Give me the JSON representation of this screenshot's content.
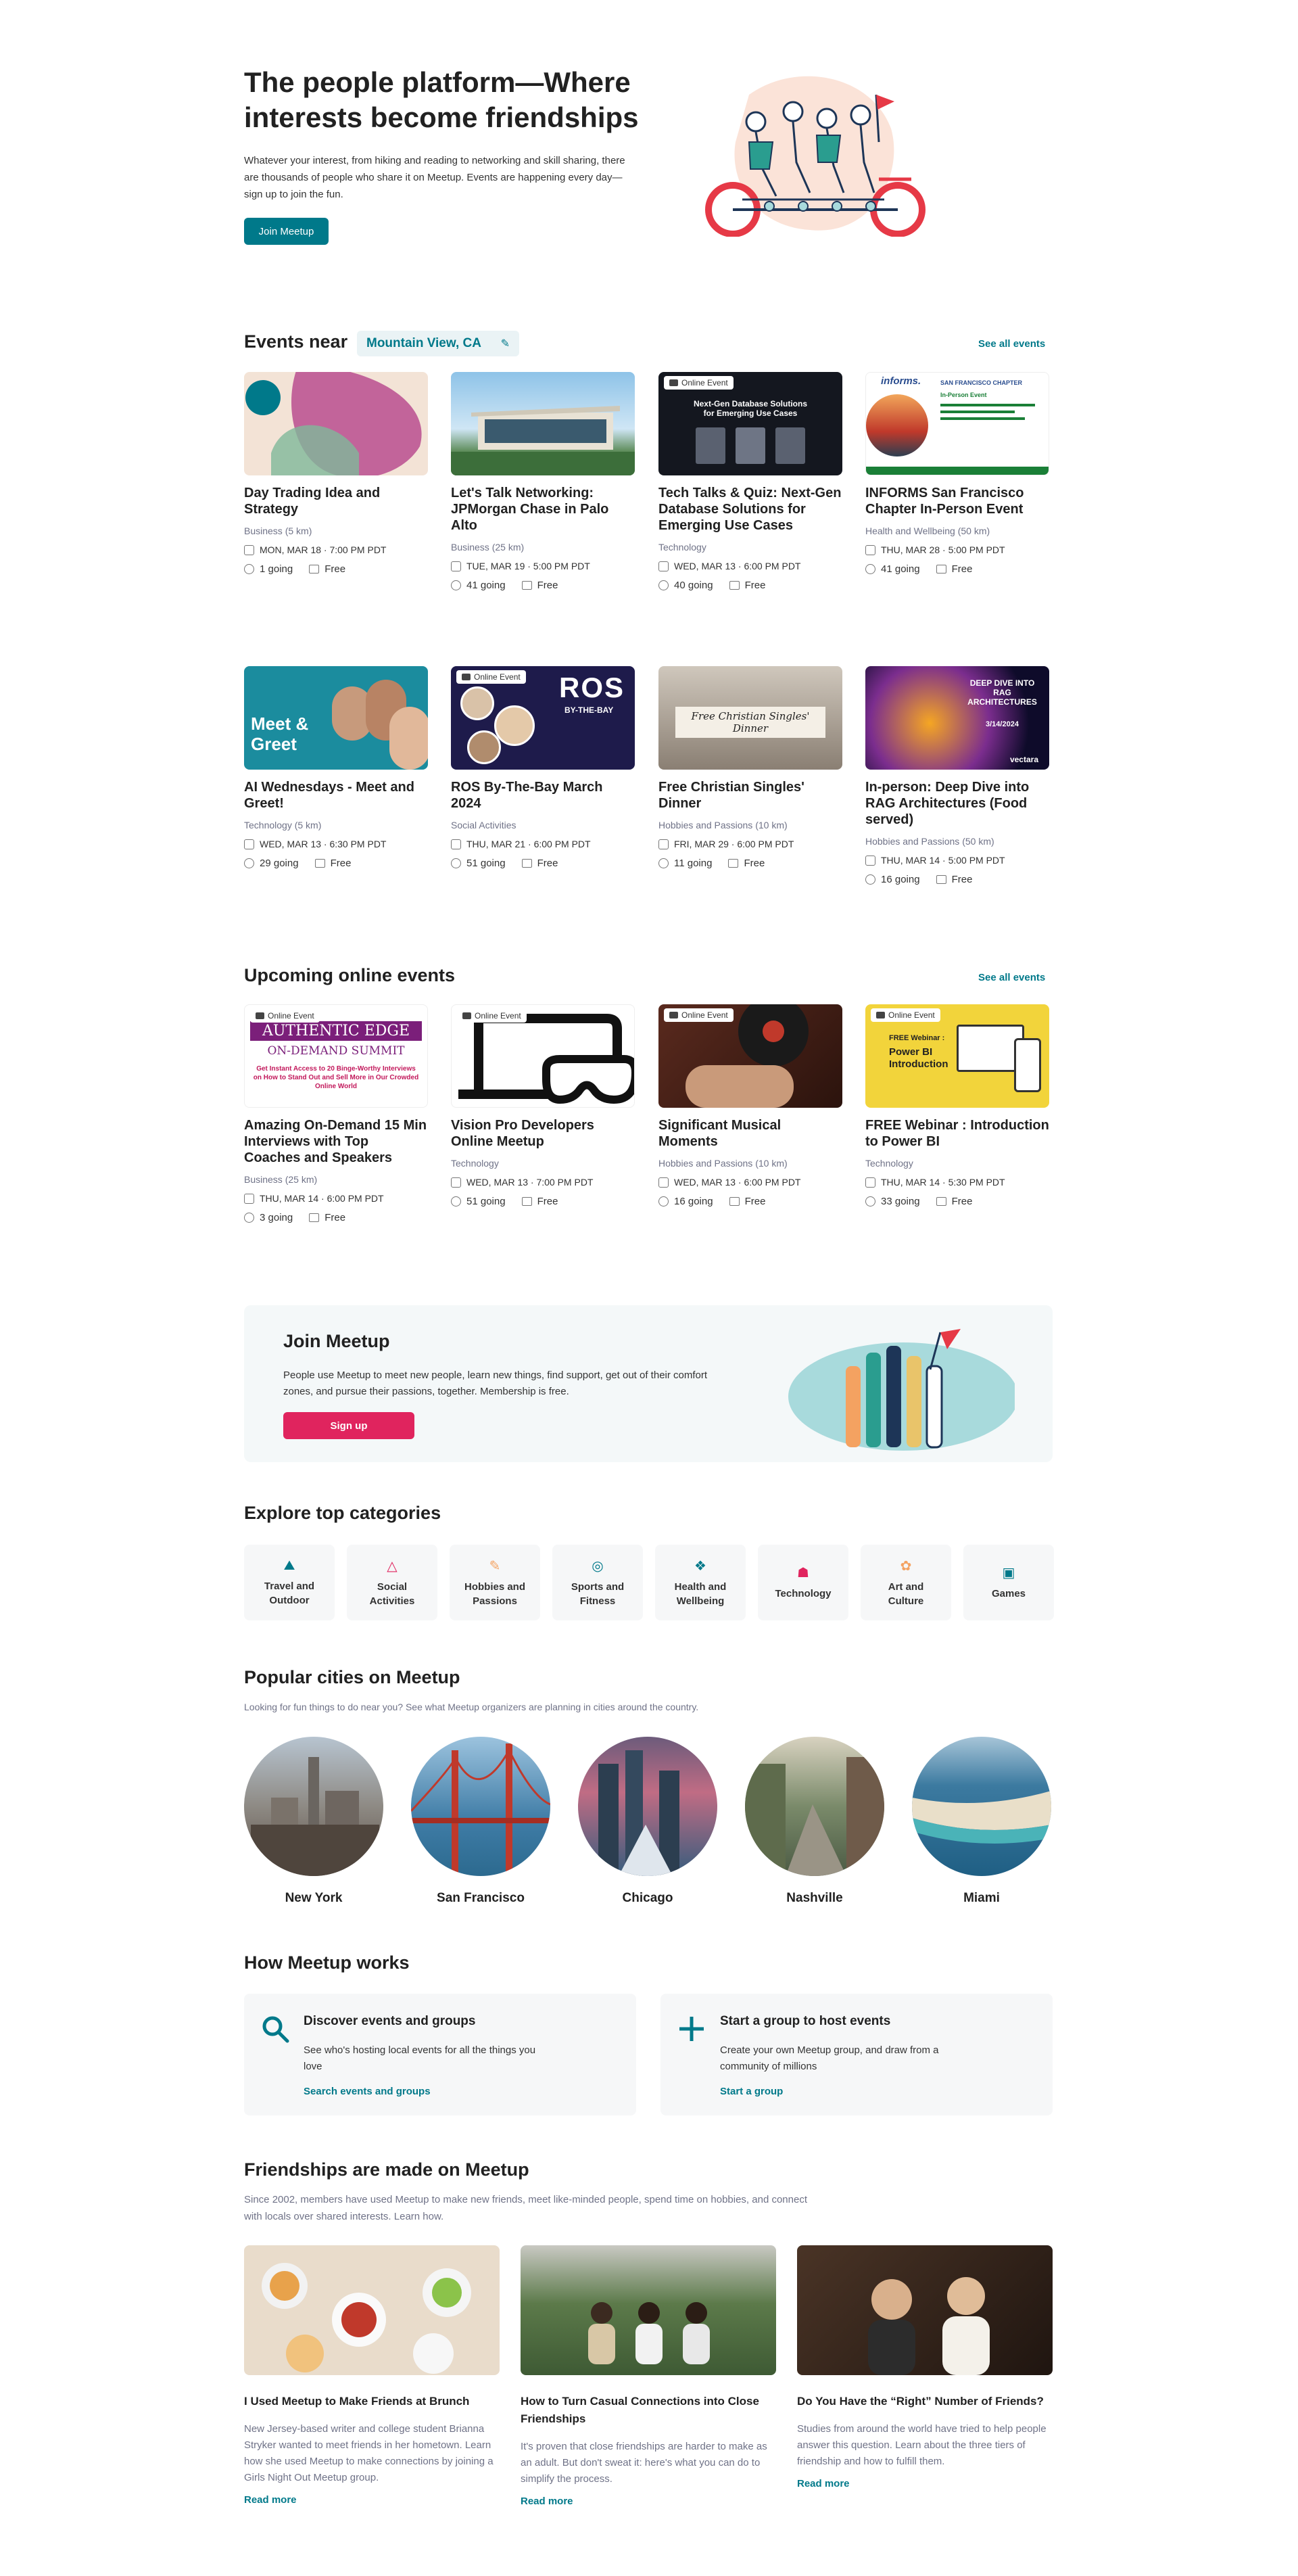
{
  "hero": {
    "title": "The people platform—Where interests become friendships",
    "description": "Whatever your interest, from hiking and reading to networking and skill sharing, there are thousands of people who share it on Meetup. Events are happening every day—sign up to join the fun.",
    "cta": "Join Meetup"
  },
  "events_near": {
    "title": "Events near",
    "location": "Mountain View, CA",
    "see_all": "See all events",
    "cards": [
      {
        "title": "Day Trading Idea and Strategy",
        "group": "Business (5 km)",
        "date": "MON, MAR 18 · 7:00 PM PDT",
        "going": "1 going",
        "price": "Free",
        "badge": ""
      },
      {
        "title": "Let's Talk Networking: JPMorgan Chase in Palo Alto",
        "group": "Business (25 km)",
        "date": "TUE, MAR 19 · 5:00 PM PDT",
        "going": "41 going",
        "price": "Free",
        "badge": ""
      },
      {
        "title": "Tech Talks & Quiz: Next-Gen Database Solutions for Emerging Use Cases",
        "group": "Technology",
        "date": "WED, MAR 13 · 6:00 PM PDT",
        "going": "40 going",
        "price": "Free",
        "badge": "Online Event"
      },
      {
        "title": "INFORMS San Francisco Chapter In-Person Event",
        "group": "Health and Wellbeing (50 km)",
        "date": "THU, MAR 28 · 5:00 PM PDT",
        "going": "41 going",
        "price": "Free",
        "badge": ""
      },
      {
        "title": "AI Wednesdays - Meet and Greet!",
        "group": "Technology (5 km)",
        "date": "WED, MAR 13 · 6:30 PM PDT",
        "going": "29 going",
        "price": "Free",
        "badge": ""
      },
      {
        "title": "ROS By-The-Bay March 2024",
        "group": "Social Activities",
        "date": "THU, MAR 21 · 6:00 PM PDT",
        "going": "51 going",
        "price": "Free",
        "badge": "Online Event"
      },
      {
        "title": "Free Christian Singles' Dinner",
        "group": "Hobbies and Passions (10 km)",
        "date": "FRI, MAR 29 · 6:00 PM PDT",
        "going": "11 going",
        "price": "Free",
        "badge": ""
      },
      {
        "title": "In-person: Deep Dive into RAG Architectures (Food served)",
        "group": "Hobbies and Passions (50 km)",
        "date": "THU, MAR 14 · 5:00 PM PDT",
        "going": "16 going",
        "price": "Free",
        "badge": ""
      }
    ]
  },
  "online_events": {
    "title": "Upcoming online events",
    "see_all": "See all events",
    "cards": [
      {
        "title": "Amazing On-Demand 15 Min Interviews with Top Coaches and Speakers",
        "group": "Business (25 km)",
        "date": "THU, MAR 14 · 6:00 PM PDT",
        "going": "3 going",
        "price": "Free",
        "badge": "Online Event"
      },
      {
        "title": "Vision Pro Developers Online Meetup",
        "group": "Technology",
        "date": "WED, MAR 13 · 7:00 PM PDT",
        "going": "51 going",
        "price": "Free",
        "badge": "Online Event"
      },
      {
        "title": "Significant Musical Moments",
        "group": "Hobbies and Passions (10 km)",
        "date": "WED, MAR 13 · 6:00 PM PDT",
        "going": "16 going",
        "price": "Free",
        "badge": "Online Event"
      },
      {
        "title": "FREE Webinar : Introduction to Power BI",
        "group": "Technology",
        "date": "THU, MAR 14 · 5:30 PM PDT",
        "going": "33 going",
        "price": "Free",
        "badge": "Online Event"
      }
    ]
  },
  "image_text": {
    "db_title": "Next-Gen Database Solutions for Emerging Use Cases",
    "meet": "Meet &",
    "greet": "Greet",
    "ros": "ROS",
    "ros_sub": "BY-THE-BAY",
    "dinner": "Free Christian Singles' Dinner",
    "rag": "DEEP DIVE INTO RAG ARCHITECTURES",
    "rag_date": "3/14/2024",
    "vectara": "vectara",
    "informs": "informs.",
    "informs_chapter": "SAN FRANCISCO CHAPTER",
    "informs_event": "In-Person Event",
    "authentic": "AUTHENTIC EDGE",
    "ondemand": "ON-DEMAND SUMMIT",
    "ondemand_sub": "Get Instant Access to 20 Binge-Worthy Interviews on How to Stand Out and Sell More in Our Crowded Online World",
    "powerbi_free": "FREE Webinar :",
    "powerbi": "Power BI Introduction"
  },
  "join_banner": {
    "title": "Join Meetup",
    "description": "People use Meetup to meet new people, learn new things, find support, get out of their comfort zones, and pursue their passions, together. Membership is free.",
    "cta": "Sign up"
  },
  "categories": {
    "title": "Explore top categories",
    "items": [
      {
        "label": "Travel and Outdoor",
        "icon": "hiking-icon"
      },
      {
        "label": "Social Activities",
        "icon": "social-icon"
      },
      {
        "label": "Hobbies and Passions",
        "icon": "hobbies-icon"
      },
      {
        "label": "Sports and Fitness",
        "icon": "sports-icon"
      },
      {
        "label": "Health and Wellbeing",
        "icon": "health-icon"
      },
      {
        "label": "Technology",
        "icon": "technology-icon"
      },
      {
        "label": "Art and Culture",
        "icon": "art-icon"
      },
      {
        "label": "Games",
        "icon": "games-icon"
      }
    ]
  },
  "cities": {
    "title": "Popular cities on Meetup",
    "subtitle": "Looking for fun things to do near you? See what Meetup organizers are planning in cities around the country.",
    "items": [
      "New York",
      "San Francisco",
      "Chicago",
      "Nashville",
      "Miami"
    ]
  },
  "how_it_works": {
    "title": "How Meetup works",
    "items": [
      {
        "title": "Discover events and groups",
        "description": "See who's hosting local events for all the things you love",
        "link": "Search events and groups"
      },
      {
        "title": "Start a group to host events",
        "description": "Create your own Meetup group, and draw from a community of millions",
        "link": "Start a group"
      }
    ]
  },
  "friendships": {
    "title": "Friendships are made on Meetup",
    "subtitle": "Since 2002, members have used Meetup to make new friends, meet like-minded people, spend time on hobbies, and connect with locals over shared interests. Learn how.",
    "stories": [
      {
        "title": "I Used Meetup to Make Friends at Brunch",
        "description": "New Jersey-based writer and college student Brianna Stryker wanted to meet friends in her hometown. Learn how she used Meetup to make connections by joining a Girls Night Out Meetup group.",
        "link": "Read more"
      },
      {
        "title": "How to Turn Casual Connections into Close Friendships",
        "description": "It's proven that close friendships are harder to make as an adult. But don't sweat it: here's what you can do to simplify the process.",
        "link": "Read more"
      },
      {
        "title": "Do You Have the “Right” Number of Friends?",
        "description": "Studies from around the world have tried to help people answer this question. Learn about the three tiers of friendship and how to fulfill them.",
        "link": "Read more"
      }
    ]
  },
  "colors": {
    "accent": "#00798a",
    "signup": "#e0245e",
    "text": "#212121"
  }
}
